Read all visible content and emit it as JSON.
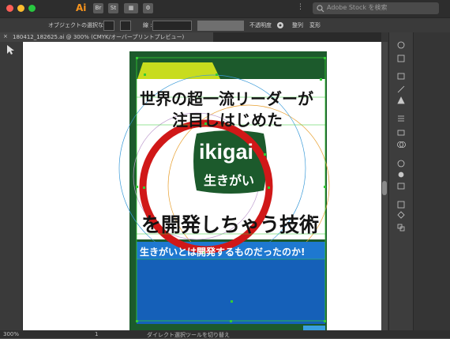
{
  "app": {
    "name": "Ai",
    "app_switcher": [
      "Br",
      "St"
    ],
    "search_placeholder": "Adobe Stock を検索",
    "colors": {
      "brand": "#f7941d",
      "dark_green": "#1c5a2c",
      "lime": "#c8dc1e",
      "red_circle": "#d01818",
      "blue": "#1560b8",
      "selection_green": "#34cc34"
    }
  },
  "controlbar": {
    "no_selection": "オブジェクトの選択なし",
    "stroke_label": "線 :",
    "opacity_label": "不透明度",
    "align_label": "整列",
    "transform_label": "変形"
  },
  "document": {
    "tab_title": "180412_182625.ai @ 300% (CMYK/オーバープリントプレビュー)",
    "close_symbol": "×"
  },
  "artwork": {
    "headline_line1": "世界の超一流リーダーが",
    "headline_line2": "注目しはじめた",
    "ikigai_latin": "ikigai",
    "ikigai_kana": "生きがい",
    "headline_line3": "を開発しちゃう技術",
    "banner_text": "生きがいとは開発するものだったのか!"
  },
  "statusbar": {
    "zoom": "300%",
    "artboard": "1",
    "tool_hint": "ダイレクト選択ツールを切り替え"
  },
  "icons": {
    "left_toolbar": [
      "selection-tool-icon",
      "direct-selection-tool-icon"
    ],
    "right_panel": [
      "color-icon",
      "swatches-icon",
      "image-icon",
      "brushes-icon",
      "symbols-icon",
      "stroke-icon",
      "gradient-icon",
      "transparency-icon",
      "appearance-icon",
      "graphic-styles-icon",
      "layers-icon",
      "artboards-icon",
      "links-icon",
      "align-icon",
      "pathfinder-icon"
    ]
  }
}
